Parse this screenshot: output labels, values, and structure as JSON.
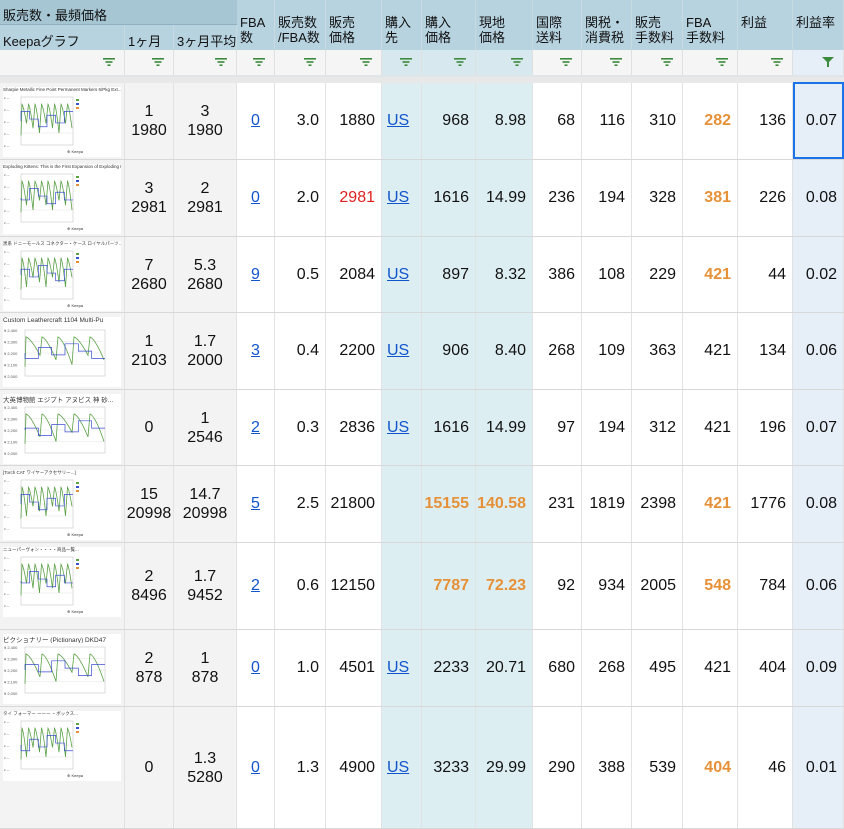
{
  "header": {
    "group_title": "販売数・最頻価格",
    "columns": [
      {
        "key": "graph",
        "label": "Keepaグラフ"
      },
      {
        "key": "m1",
        "label": "1ヶ月"
      },
      {
        "key": "m3",
        "label": "3ヶ月平均"
      },
      {
        "key": "fba",
        "label": "FBA\n数"
      },
      {
        "key": "ratio",
        "label": "販売数\n/FBA数"
      },
      {
        "key": "sell",
        "label": "販売\n価格"
      },
      {
        "key": "src",
        "label": "購入\n先"
      },
      {
        "key": "buy",
        "label": "購入\n価格"
      },
      {
        "key": "local",
        "label": "現地\n価格"
      },
      {
        "key": "ship",
        "label": "国際\n送料"
      },
      {
        "key": "tax",
        "label": "関税・\n消費税"
      },
      {
        "key": "fee",
        "label": "販売\n手数料"
      },
      {
        "key": "fbafee",
        "label": "FBA\n手数料"
      },
      {
        "key": "profit",
        "label": "利益"
      },
      {
        "key": "rate",
        "label": "利益率"
      }
    ]
  },
  "colors": {
    "header_bg": "#b7d3e0",
    "accent_link": "#1155cc",
    "orange": "#e69138",
    "red": "#e02020",
    "filter_icon": "#3c8a3c",
    "selection": "#1a73e8"
  },
  "rows": [
    {
      "thumb_title": "Sharpie Metallic Fine Point Permanent Markers 6/Pkg Ext...",
      "thumb_style": "small",
      "m1": [
        "1",
        "1980"
      ],
      "m3": [
        "3",
        "1980"
      ],
      "fba": "0",
      "ratio": "3.0",
      "sell": "1880",
      "sell_red": false,
      "src": "US",
      "buy": "968",
      "buy_orange": false,
      "local": "8.98",
      "local_orange": false,
      "ship": "68",
      "tax": "116",
      "fee": "310",
      "fbafee": "282",
      "fbafee_orange": true,
      "profit": "136",
      "rate": "0.07"
    },
    {
      "thumb_title": "Exploding Kittens: This is the First Expansion of Exploding Kitt...",
      "thumb_style": "small",
      "m1": [
        "3",
        "2981"
      ],
      "m3": [
        "2",
        "2981"
      ],
      "fba": "0",
      "ratio": "2.0",
      "sell": "2981",
      "sell_red": true,
      "src": "US",
      "buy": "1616",
      "buy_orange": false,
      "local": "14.99",
      "local_orange": false,
      "ship": "236",
      "tax": "194",
      "fee": "328",
      "fbafee": "381",
      "fbafee_orange": true,
      "profit": "226",
      "rate": "0.08"
    },
    {
      "thumb_title": "黒系 ドニーモールス コネクター・ケース ロイヤルパーツ...",
      "thumb_style": "small",
      "m1": [
        "7",
        "2680"
      ],
      "m3": [
        "5.3",
        "2680"
      ],
      "fba": "9",
      "ratio": "0.5",
      "sell": "2084",
      "sell_red": false,
      "src": "US",
      "buy": "897",
      "buy_orange": false,
      "local": "8.32",
      "local_orange": false,
      "ship": "386",
      "tax": "108",
      "fee": "229",
      "fbafee": "421",
      "fbafee_orange": true,
      "profit": "44",
      "rate": "0.02"
    },
    {
      "thumb_title": "Custom Leathercraft 1104 Multi-Pu",
      "thumb_style": "big",
      "m1": [
        "1",
        "2103"
      ],
      "m3": [
        "1.7",
        "2000"
      ],
      "fba": "3",
      "ratio": "0.4",
      "sell": "2200",
      "sell_red": false,
      "src": "US",
      "buy": "906",
      "buy_orange": false,
      "local": "8.40",
      "local_orange": false,
      "ship": "268",
      "tax": "109",
      "fee": "363",
      "fbafee": "421",
      "fbafee_orange": false,
      "profit": "134",
      "rate": "0.06"
    },
    {
      "thumb_title": "大英博物館 エジプト アヌビス 神 砂...",
      "thumb_style": "big",
      "m1": [
        "0",
        ""
      ],
      "m3": [
        "1",
        "2546"
      ],
      "fba": "2",
      "ratio": "0.3",
      "sell": "2836",
      "sell_red": false,
      "src": "US",
      "buy": "1616",
      "buy_orange": false,
      "local": "14.99",
      "local_orange": false,
      "ship": "97",
      "tax": "194",
      "fee": "312",
      "fbafee": "421",
      "fbafee_orange": false,
      "profit": "196",
      "rate": "0.07"
    },
    {
      "thumb_title": "[Torch CAT ワイヤーアクセサリー...]",
      "thumb_style": "small",
      "m1": [
        "15",
        "20998"
      ],
      "m3": [
        "14.7",
        "20998"
      ],
      "fba": "5",
      "ratio": "2.5",
      "sell": "21800",
      "sell_red": false,
      "src": "",
      "buy": "15155",
      "buy_orange": true,
      "local": "140.58",
      "local_orange": true,
      "ship": "231",
      "tax": "1819",
      "fee": "2398",
      "fbafee": "421",
      "fbafee_orange": true,
      "profit": "1776",
      "rate": "0.08"
    },
    {
      "thumb_title": "ニューパーヴォン・・・・商品一覧...",
      "thumb_style": "small",
      "m1": [
        "2",
        "8496"
      ],
      "m3": [
        "1.7",
        "9452"
      ],
      "fba": "2",
      "ratio": "0.6",
      "sell": "12150",
      "sell_red": false,
      "src": "",
      "buy": "7787",
      "buy_orange": true,
      "local": "72.23",
      "local_orange": true,
      "ship": "92",
      "tax": "934",
      "fee": "2005",
      "fbafee": "548",
      "fbafee_orange": true,
      "profit": "784",
      "rate": "0.06"
    },
    {
      "thumb_title": "ピクショナリー (Pictionary) DKD47",
      "thumb_style": "big",
      "m1": [
        "2",
        "878"
      ],
      "m3": [
        "1",
        "878"
      ],
      "fba": "0",
      "ratio": "1.0",
      "sell": "4501",
      "sell_red": false,
      "src": "US",
      "buy": "2233",
      "buy_orange": false,
      "local": "20.71",
      "local_orange": false,
      "ship": "680",
      "tax": "268",
      "fee": "495",
      "fbafee": "421",
      "fbafee_orange": false,
      "profit": "404",
      "rate": "0.09"
    },
    {
      "thumb_title": "タイ フォーマー ーーー ・ボックス...",
      "thumb_style": "small",
      "m1": [
        "0",
        ""
      ],
      "m3": [
        "1.3",
        "5280"
      ],
      "fba": "0",
      "ratio": "1.3",
      "sell": "4900",
      "sell_red": false,
      "src": "US",
      "buy": "3233",
      "buy_orange": false,
      "local": "29.99",
      "local_orange": false,
      "ship": "290",
      "tax": "388",
      "fee": "539",
      "fbafee": "404",
      "fbafee_orange": true,
      "profit": "46",
      "rate": "0.01"
    }
  ]
}
